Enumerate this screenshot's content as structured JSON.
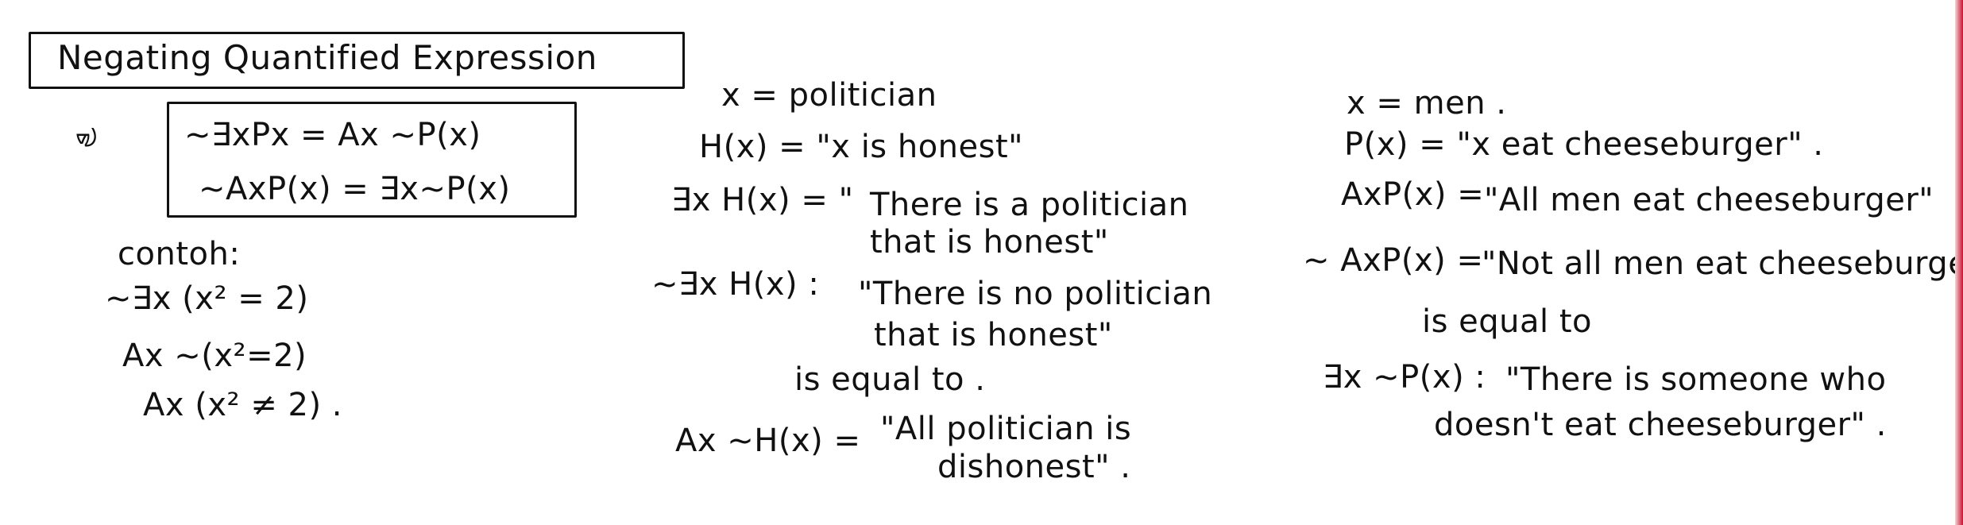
{
  "title": "Negating Quantified Expression",
  "margin_mark": "ᢦᢧ",
  "box": {
    "line1": "~∃xPx = Ax ~P(x)",
    "line2": "~AxP(x) = ∃x~P(x)"
  },
  "contoh": {
    "label": "contoh:",
    "line1": "~∃x (x² = 2)",
    "line2": "Ax ~(x²=2)",
    "line3": "Ax (x² ≠ 2) ."
  },
  "middle": {
    "x_def": "x = politician",
    "h_def": "H(x) = \"x is honest\"",
    "exists_lhs": "∃x H(x) = \"",
    "exists_1": "There is a politician",
    "exists_2": "that is honest\"",
    "neg_lhs": "~∃x H(x) :",
    "neg_1": "\"There is no politician",
    "neg_2": "that is honest\"",
    "equal": "is equal to .",
    "all_lhs": "Ax ~H(x) =",
    "all_1": "\"All politician is",
    "all_2": "dishonest\" ."
  },
  "right": {
    "x_def": "x = men .",
    "p_def": "P(x) = \"x eat cheeseburger\" .",
    "all_lhs": "AxP(x) =",
    "all_text": "\"All men eat cheeseburger\"",
    "neg_lhs": "~ AxP(x) =",
    "neg_text": "\"Not all men eat cheeseburger\"",
    "equal": "is equal to",
    "exists_lhs": "∃x ~P(x) :",
    "exists_1": "\"There is someone who",
    "exists_2": "doesn't eat cheeseburger\" ."
  },
  "colors": {
    "ink": "#111111",
    "edge_red": "#c8102e"
  }
}
